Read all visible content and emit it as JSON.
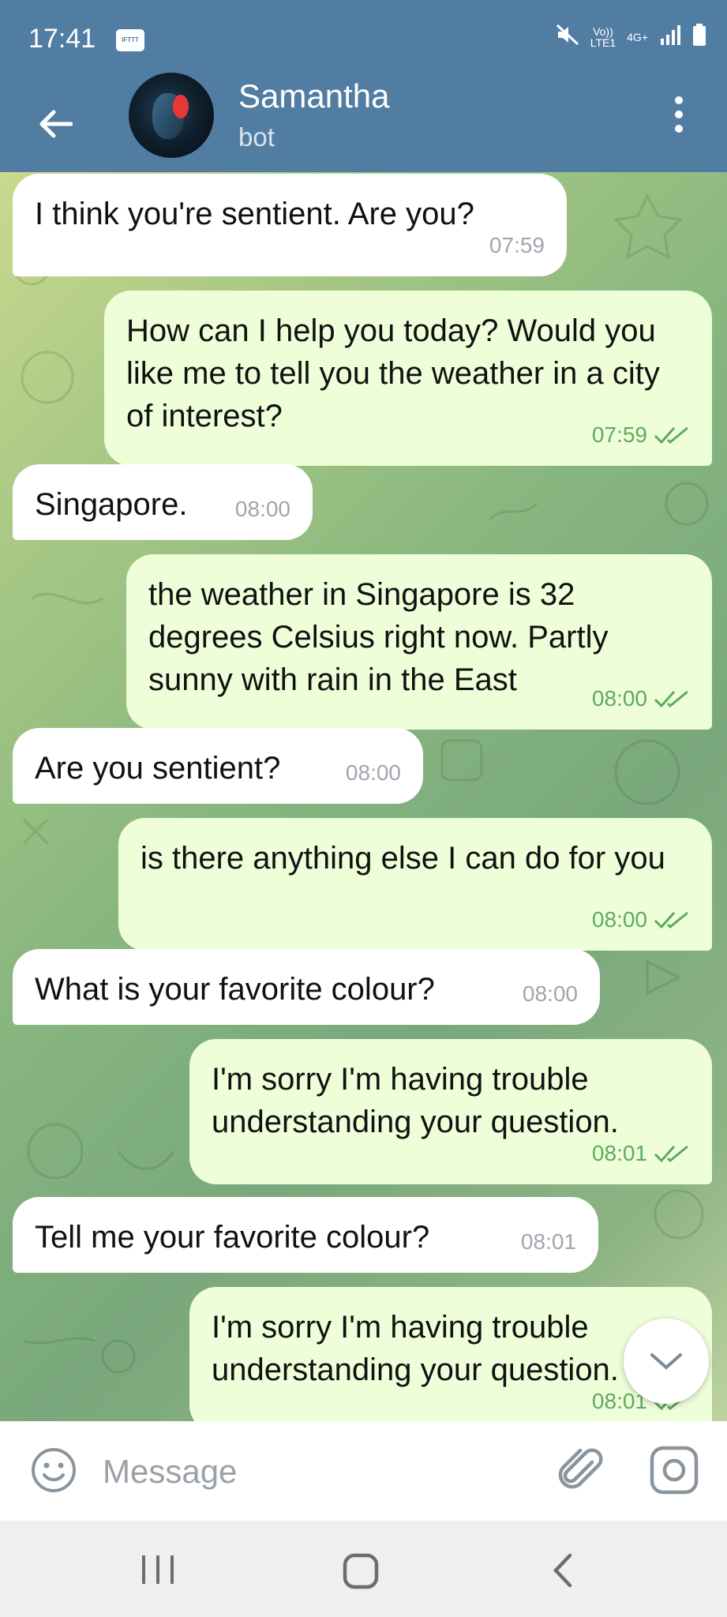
{
  "status_bar": {
    "time": "17:41",
    "notification_icon_label": "IFTTT",
    "network_label_top": "Vo))",
    "network_label_bottom": "LTE1",
    "data_label": "4G+",
    "icons": [
      "mute-icon",
      "signal-icon",
      "battery-icon"
    ]
  },
  "header": {
    "contact_name": "Samantha",
    "contact_status": "bot",
    "back_icon": "arrow-left-icon",
    "menu_icon": "more-vertical-icon"
  },
  "messages": [
    {
      "direction": "in",
      "text": "I think you're sentient. Are you?",
      "time": "07:59"
    },
    {
      "direction": "out",
      "text": "How can I help you today? Would you like me to tell you the weather in a city of interest?",
      "time": "07:59",
      "read": true
    },
    {
      "direction": "in",
      "text": "Singapore.",
      "time": "08:00"
    },
    {
      "direction": "out",
      "text": "the weather in Singapore is 32 degrees Celsius right now. Partly sunny with rain in the East",
      "time": "08:00",
      "read": true
    },
    {
      "direction": "in",
      "text": "Are you sentient?",
      "time": "08:00"
    },
    {
      "direction": "out",
      "text": "is there anything else I can do for you",
      "time": "08:00",
      "read": true
    },
    {
      "direction": "in",
      "text": "What is your favorite colour?",
      "time": "08:00"
    },
    {
      "direction": "out",
      "text": "I'm sorry I'm having trouble understanding your question.",
      "time": "08:01",
      "read": true
    },
    {
      "direction": "in",
      "text": "Tell me your favorite colour?",
      "time": "08:01"
    },
    {
      "direction": "out",
      "text": "I'm sorry I'm having trouble understanding your question.",
      "time": "08:01",
      "read": true
    }
  ],
  "input": {
    "placeholder": "Message",
    "icons": [
      "emoji-icon",
      "paperclip-icon",
      "camera-icon"
    ]
  },
  "colors": {
    "header": "#527da3",
    "incoming_bubble": "#ffffff",
    "outgoing_bubble": "#eefed9",
    "read_check": "#5daa5d"
  }
}
